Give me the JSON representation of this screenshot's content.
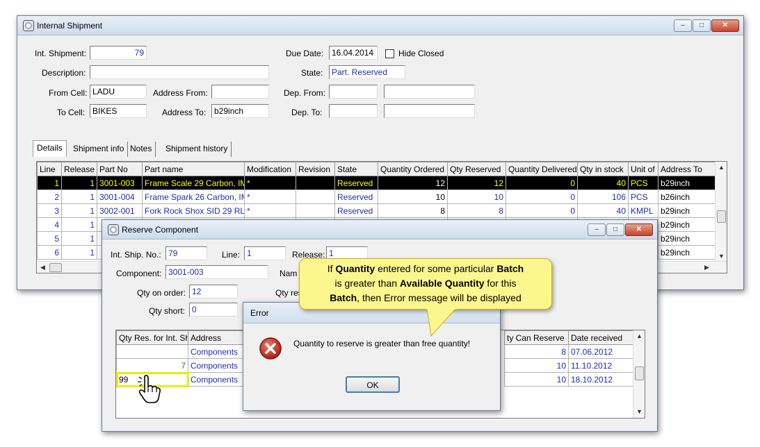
{
  "main_window": {
    "title": "Internal Shipment",
    "fields": {
      "int_shipment_label": "Int. Shipment:",
      "int_shipment_value": "79",
      "description_label": "Description:",
      "description_value": "",
      "from_cell_label": "From Cell:",
      "from_cell_value": "LADU",
      "to_cell_label": "To Cell:",
      "to_cell_value": "BIKES",
      "address_from_label": "Address From:",
      "address_from_value": "",
      "address_to_label": "Address To:",
      "address_to_value": "b29inch",
      "due_date_label": "Due Date:",
      "due_date_value": "16.04.2014",
      "hide_closed_label": "Hide Closed",
      "state_label": "State:",
      "state_value": "Part. Reserved",
      "dep_from_label": "Dep. From:",
      "dep_to_label": "Dep. To:"
    },
    "tabs": [
      "Details",
      "Shipment info",
      "Notes",
      "Shipment history"
    ],
    "grid": {
      "columns": [
        "Line",
        "Release",
        "Part No",
        "Part name",
        "Modification",
        "Revision",
        "State",
        "Quantity Ordered",
        "Qty Reserved",
        "Quantity Delivered",
        "Qty in stock",
        "Unit of",
        "Address To"
      ],
      "rows": [
        {
          "line": "1",
          "release": "1",
          "part_no": "3001-003",
          "part_name": "Frame Scale 29 Carbon, IMI",
          "modification": "*",
          "revision": "",
          "state": "Reserved",
          "qty_ordered": "12",
          "qty_reserved": "12",
          "qty_delivered": "0",
          "qty_stock": "40",
          "unit": "PCS",
          "address_to": "b29inch"
        },
        {
          "line": "2",
          "release": "1",
          "part_no": "3001-004",
          "part_name": "Frame Spark 26 Carbon, IM",
          "modification": "*",
          "revision": "",
          "state": "Reserved",
          "qty_ordered": "10",
          "qty_reserved": "10",
          "qty_delivered": "0",
          "qty_stock": "106",
          "unit": "PCS",
          "address_to": "b26inch"
        },
        {
          "line": "3",
          "release": "1",
          "part_no": "3002-001",
          "part_name": "Fork Rock Shox SID 29 RL",
          "modification": "*",
          "revision": "",
          "state": "Reserved",
          "qty_ordered": "8",
          "qty_reserved": "8",
          "qty_delivered": "0",
          "qty_stock": "40",
          "unit": "KMPL",
          "address_to": "b29inch"
        },
        {
          "line": "4",
          "release": "1",
          "address_to": "b29inch"
        },
        {
          "line": "5",
          "release": "1",
          "address_to": "b29inch"
        },
        {
          "line": "6",
          "release": "1",
          "address_to": "b29inch"
        }
      ]
    }
  },
  "reserve_window": {
    "title": "Reserve Component",
    "int_ship_no_label": "Int. Ship. No.:",
    "int_ship_no_value": "79",
    "line_label": "Line:",
    "line_value": "1",
    "release_label": "Release:",
    "release_value": "1",
    "component_label": "Component:",
    "component_value": "3001-003",
    "name_label": "Nam",
    "qty_on_order_label": "Qty on order:",
    "qty_on_order_value": "12",
    "qty_res_label": "Qty res",
    "qty_short_label": "Qty short:",
    "qty_short_value": "0",
    "grid": {
      "col_qty_res": "Qty Res. for Int. Sh",
      "col_address": "Address",
      "col_can_reserve": "ty Can Reserve",
      "col_date": "Date received",
      "rows": [
        {
          "qty_res": "",
          "address": "Components",
          "can_reserve": "8",
          "date": "07.06.2012"
        },
        {
          "qty_res": "7",
          "address": "Components",
          "can_reserve": "10",
          "date": "11.10.2012"
        },
        {
          "qty_res": "99",
          "address": "Components",
          "can_reserve": "10",
          "date": "18.10.2012"
        }
      ]
    }
  },
  "error_dialog": {
    "title": "Error",
    "message": "Quantity to reserve is greater than free quantity!",
    "ok_label": "OK",
    "icon": "error-x-icon"
  },
  "callout": {
    "l1a": "If ",
    "l1b": "Quantity",
    "l1c": " entered for some particular ",
    "l1d": "Batch",
    "l2a": "is greater than ",
    "l2b": "Available Quantity",
    "l2c": " for this",
    "l3a": "Batch",
    "l3b": ", then Error message will be displayed"
  },
  "colors": {
    "selected_row_bg": "#000000",
    "selected_row_text": "#ffff00",
    "value_text": "#1a2fb8",
    "callout_bg": "#fcf68f",
    "highlight": "#e6f000"
  }
}
